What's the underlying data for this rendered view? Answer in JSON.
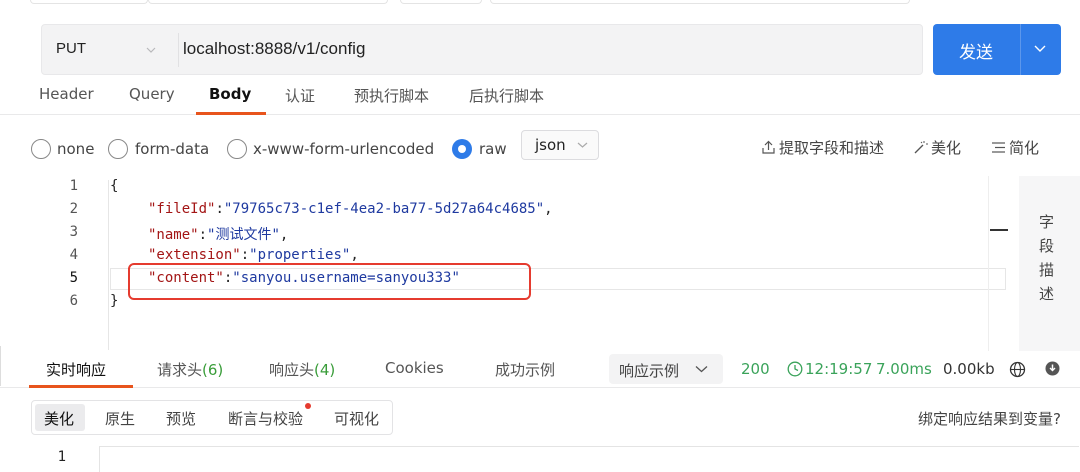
{
  "request": {
    "method": "PUT",
    "url": "localhost:8888/v1/config",
    "send_label": "发送"
  },
  "request_tabs": [
    {
      "label": "Header"
    },
    {
      "label": "Query"
    },
    {
      "label": "Body",
      "active": true
    },
    {
      "label": "认证"
    },
    {
      "label": "预执行脚本"
    },
    {
      "label": "后执行脚本"
    }
  ],
  "body_types": [
    {
      "label": "none",
      "checked": false
    },
    {
      "label": "form-data",
      "checked": false
    },
    {
      "label": "x-www-form-urlencoded",
      "checked": false
    },
    {
      "label": "raw",
      "checked": true
    }
  ],
  "format_select": "json",
  "toolbar": {
    "extract_label": "提取字段和描述",
    "beautify_label": "美化",
    "simplify_label": "简化"
  },
  "editor": {
    "line_numbers": [
      "1",
      "2",
      "3",
      "4",
      "5",
      "6"
    ],
    "current_line": 5,
    "lines": {
      "l1": "{",
      "l2_key": "\"fileId\"",
      "l2_val": "\"79765c73-c1ef-4ea2-ba77-5d27a64c4685\"",
      "l3_key": "\"name\"",
      "l3_val": "\"测试文件\"",
      "l4_key": "\"extension\"",
      "l4_val": "\"properties\"",
      "l5_key": "\"content\"",
      "l5_val": "\"sanyou.username=sanyou333\"",
      "l6": "}"
    },
    "colon": ":",
    "comma": ","
  },
  "side_panel": {
    "label": "字段描述"
  },
  "response_tabs": [
    {
      "label": "实时响应",
      "active": true
    },
    {
      "label": "请求头",
      "count": "(6)"
    },
    {
      "label": "响应头",
      "count": "(4)"
    },
    {
      "label": "Cookies"
    },
    {
      "label": "成功示例"
    }
  ],
  "response_example_select": "响应示例",
  "response_stats": {
    "status": "200",
    "time": "12:19:57",
    "duration": "7.00ms",
    "size": "0.00kb"
  },
  "view_tabs": [
    {
      "label": "美化",
      "active": true
    },
    {
      "label": "原生"
    },
    {
      "label": "预览"
    },
    {
      "label": "断言与校验",
      "dot": true
    },
    {
      "label": "可视化"
    }
  ],
  "bind_label": "绑定响应结果到变量?",
  "response_editor": {
    "line_numbers": [
      "1"
    ]
  },
  "colors": {
    "accent": "#2e7be8",
    "tab_underline": "#e8541c",
    "highlight_box": "#e53b2f",
    "status_ok": "#3aa35a"
  }
}
